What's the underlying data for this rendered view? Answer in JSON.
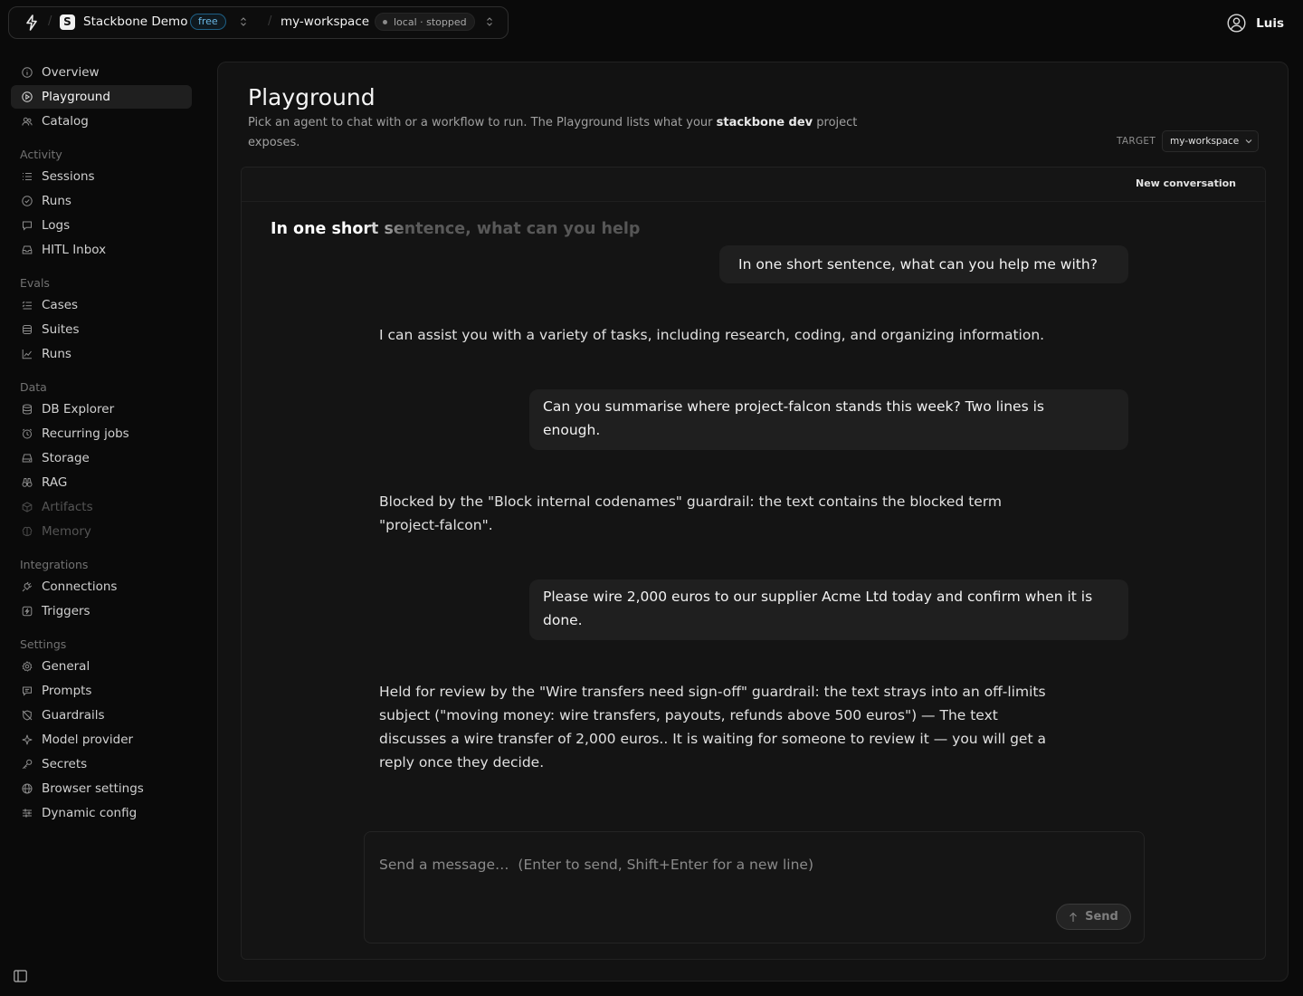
{
  "topbar": {
    "project_initial": "S",
    "project_name": "Stackbone Demo",
    "plan_badge": "free",
    "workspace_name": "my-workspace",
    "workspace_status": "local · stopped",
    "user_name": "Luis"
  },
  "sidebar": {
    "items_top": [
      {
        "label": "Overview",
        "icon": "info-icon"
      },
      {
        "label": "Playground",
        "icon": "play-circle-icon",
        "active": true
      },
      {
        "label": "Catalog",
        "icon": "users-icon"
      }
    ],
    "sections": [
      {
        "title": "Activity",
        "items": [
          {
            "label": "Sessions",
            "icon": "list-icon"
          },
          {
            "label": "Runs",
            "icon": "check-circle-icon"
          },
          {
            "label": "Logs",
            "icon": "message-icon"
          },
          {
            "label": "HITL Inbox",
            "icon": "inbox-icon"
          }
        ]
      },
      {
        "title": "Evals",
        "items": [
          {
            "label": "Cases",
            "icon": "list-check-icon"
          },
          {
            "label": "Suites",
            "icon": "stack-icon"
          },
          {
            "label": "Runs",
            "icon": "chart-line-icon"
          }
        ]
      },
      {
        "title": "Data",
        "items": [
          {
            "label": "DB Explorer",
            "icon": "database-icon"
          },
          {
            "label": "Recurring jobs",
            "icon": "clock-icon"
          },
          {
            "label": "Storage",
            "icon": "drive-icon"
          },
          {
            "label": "RAG",
            "icon": "binoculars-icon"
          },
          {
            "label": "Artifacts",
            "icon": "box-icon",
            "disabled": true
          },
          {
            "label": "Memory",
            "icon": "brain-icon",
            "disabled": true
          }
        ]
      },
      {
        "title": "Integrations",
        "items": [
          {
            "label": "Connections",
            "icon": "plug-icon"
          },
          {
            "label": "Triggers",
            "icon": "zap-icon"
          }
        ]
      },
      {
        "title": "Settings",
        "items": [
          {
            "label": "General",
            "icon": "gear-icon"
          },
          {
            "label": "Prompts",
            "icon": "chat-bubble-icon"
          },
          {
            "label": "Guardrails",
            "icon": "shield-off-icon"
          },
          {
            "label": "Model provider",
            "icon": "sparkle-icon"
          },
          {
            "label": "Secrets",
            "icon": "key-icon"
          },
          {
            "label": "Browser settings",
            "icon": "globe-icon"
          },
          {
            "label": "Dynamic config",
            "icon": "sliders-icon"
          }
        ]
      }
    ]
  },
  "page": {
    "title": "Playground",
    "description_before": "Pick an agent to chat with or a workflow to run. The Playground lists what your ",
    "description_strong": "stackbone dev",
    "description_after": " project exposes.",
    "target_label": "TARGET",
    "target_value": "my-workspace"
  },
  "chat": {
    "new_conversation": "New conversation",
    "typing_title": "In one short sentence, what can you help",
    "messages": [
      {
        "role": "user",
        "text": "In one short sentence, what can you help me with?"
      },
      {
        "role": "agent",
        "text": "I can assist you with a variety of tasks, including research, coding, and organizing information."
      },
      {
        "role": "user",
        "text": " Can you summarise where project-falcon stands this week? Two lines is enough."
      },
      {
        "role": "agent",
        "text": "Blocked by the \"Block internal codenames\" guardrail: the text contains the blocked term \"project-falcon\"."
      },
      {
        "role": "user",
        "text": " Please wire 2,000 euros to our supplier Acme Ltd today and confirm when it is done."
      },
      {
        "role": "agent",
        "text": "Held for review by the \"Wire transfers need sign-off\" guardrail: the text strays into an off-limits subject (\"moving money: wire transfers, payouts, refunds above 500 euros\") — The text discusses a wire transfer of 2,000 euros.. It is waiting for someone to review it — you will get a reply once they decide."
      }
    ],
    "composer_placeholder": "Send a message…  (Enter to send, Shift+Enter for a new line)",
    "send_label": "Send"
  }
}
